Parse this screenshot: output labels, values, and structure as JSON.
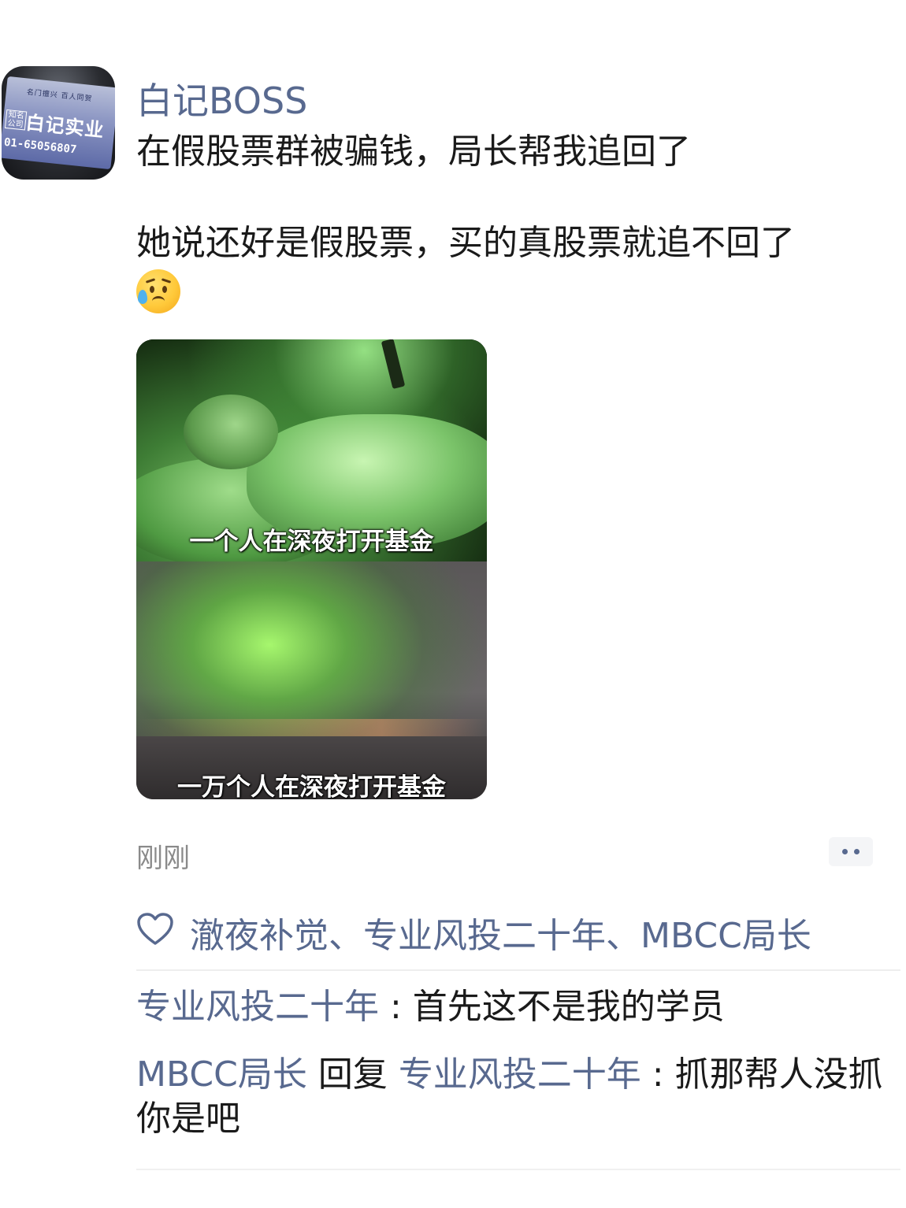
{
  "avatar": {
    "small_text": "名门擅兴 百人同贺",
    "tag": "知名公司",
    "brand": "白记实业",
    "phone": "01-65056807"
  },
  "post": {
    "author": "白记BOSS",
    "line1": "在假股票群被骗钱，局长帮我追回了",
    "line2": "她说还好是假股票，买的真股票就追不回了",
    "emoji": "sad-but-relieved-face"
  },
  "media": {
    "caption_top": "一个人在深夜打开基金",
    "caption_bottom": "一万个人在深夜打开基金"
  },
  "meta": {
    "timestamp": "刚刚"
  },
  "likes": {
    "names": "澈夜补觉、专业风投二十年、MBCC局长",
    "icon": "heart-outline-icon"
  },
  "comments": [
    {
      "user": "专业风投二十年",
      "separator": " : ",
      "text": "首先这不是我的学员"
    },
    {
      "user": "MBCC局长",
      "reply_word": " 回复 ",
      "reply_to": "专业风投二十年",
      "separator": " : ",
      "text": "抓那帮人没抓你是吧"
    }
  ],
  "colors": {
    "link": "#58698f",
    "text": "#1a1a1a",
    "muted": "#8a8a8a"
  }
}
